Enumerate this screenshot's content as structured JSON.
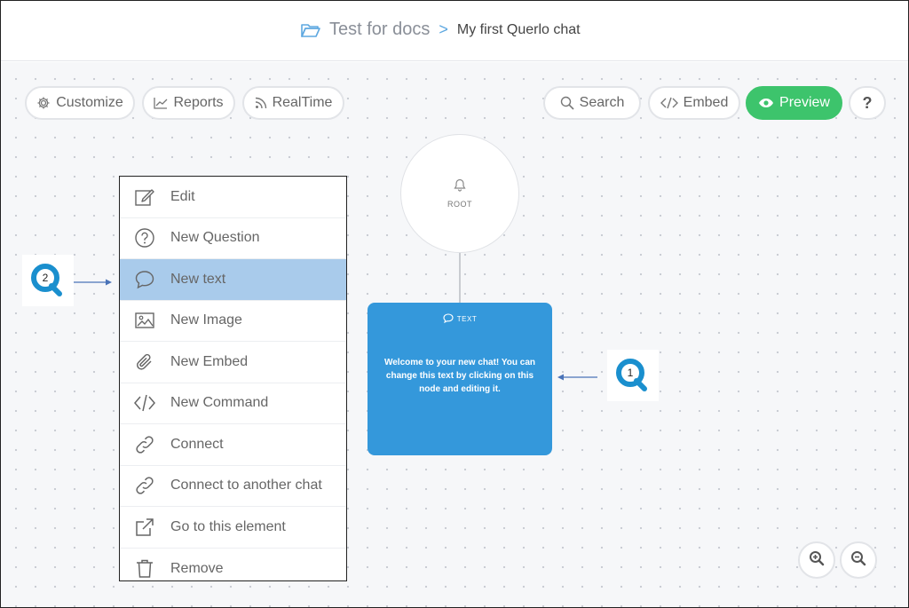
{
  "breadcrumb": {
    "folder_icon": "folder-open-icon",
    "project": "Test for docs",
    "separator": ">",
    "chat": "My first Querlo chat"
  },
  "toolbar": {
    "customize": "Customize",
    "reports": "Reports",
    "realtime": "RealTime",
    "search": "Search",
    "embed": "Embed",
    "preview": "Preview",
    "help": "?"
  },
  "colors": {
    "accent_blue": "#3498db",
    "preview_green": "#3dc46c",
    "menu_highlight": "#a9cbeb",
    "callout_blue": "#1a8fce"
  },
  "nodes": {
    "root_label": "ROOT",
    "text_type": "TEXT",
    "text_body": "Welcome to your new chat! You can change this text by clicking on this node and editing it."
  },
  "context_menu": {
    "items": [
      {
        "label": "Edit",
        "icon": "edit-icon"
      },
      {
        "label": "New Question",
        "icon": "question-circle-icon"
      },
      {
        "label": "New text",
        "icon": "speech-bubble-icon"
      },
      {
        "label": "New Image",
        "icon": "image-icon"
      },
      {
        "label": "New Embed",
        "icon": "paperclip-icon"
      },
      {
        "label": "New Command",
        "icon": "code-icon"
      },
      {
        "label": "Connect",
        "icon": "link-icon"
      },
      {
        "label": "Connect to another chat",
        "icon": "link-icon"
      },
      {
        "label": "Go to this element",
        "icon": "external-link-icon"
      },
      {
        "label": "Remove",
        "icon": "trash-icon"
      }
    ],
    "highlighted": "New text"
  },
  "callouts": {
    "one": "1",
    "two": "2"
  }
}
